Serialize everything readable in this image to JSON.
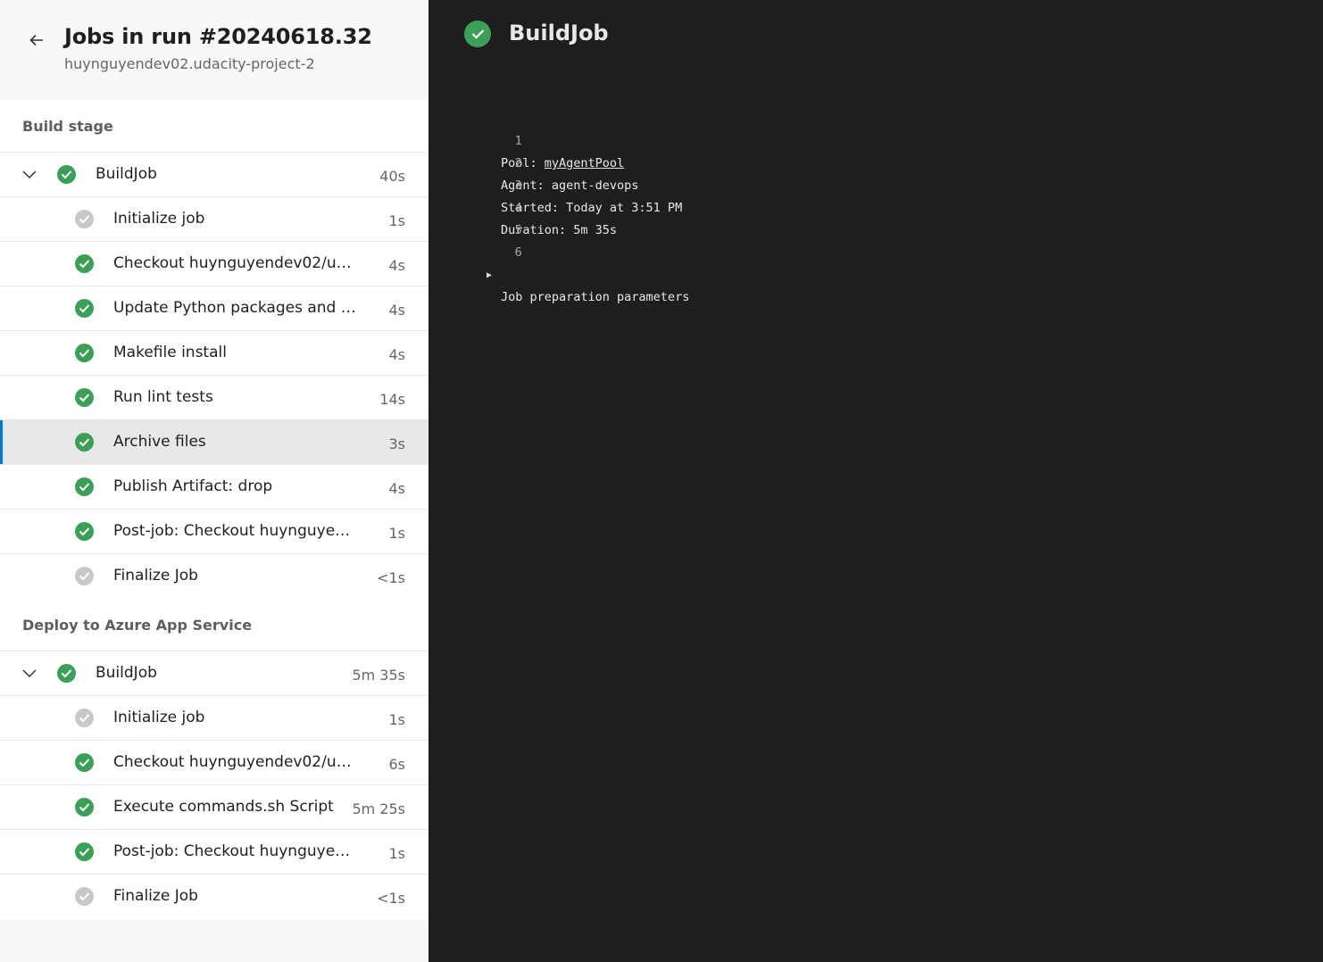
{
  "header": {
    "title": "Jobs in run #20240618.32",
    "subtitle": "huynguyendev02.udacity-project-2"
  },
  "stages": [
    {
      "name": "Build stage",
      "job": {
        "name": "BuildJob",
        "duration": "40s",
        "status": "success"
      },
      "steps": [
        {
          "name": "Initialize job",
          "duration": "1s",
          "status": "skipped"
        },
        {
          "name": "Checkout huynguyendev02/udaci...",
          "duration": "4s",
          "status": "success"
        },
        {
          "name": "Update Python packages and inst...",
          "duration": "4s",
          "status": "success"
        },
        {
          "name": "Makefile install",
          "duration": "4s",
          "status": "success"
        },
        {
          "name": "Run lint tests",
          "duration": "14s",
          "status": "success"
        },
        {
          "name": "Archive files",
          "duration": "3s",
          "status": "success",
          "selected": true
        },
        {
          "name": "Publish Artifact: drop",
          "duration": "4s",
          "status": "success"
        },
        {
          "name": "Post-job: Checkout huynguyende...",
          "duration": "1s",
          "status": "success"
        },
        {
          "name": "Finalize Job",
          "duration": "<1s",
          "status": "skipped"
        }
      ]
    },
    {
      "name": "Deploy to Azure App Service",
      "job": {
        "name": "BuildJob",
        "duration": "5m 35s",
        "status": "success"
      },
      "steps": [
        {
          "name": "Initialize job",
          "duration": "1s",
          "status": "skipped"
        },
        {
          "name": "Checkout huynguyendev02/udaci...",
          "duration": "6s",
          "status": "success"
        },
        {
          "name": "Execute commands.sh Script",
          "duration": "5m 25s",
          "status": "success"
        },
        {
          "name": "Post-job: Checkout huynguyende...",
          "duration": "1s",
          "status": "success"
        },
        {
          "name": "Finalize Job",
          "duration": "<1s",
          "status": "skipped"
        }
      ]
    }
  ],
  "detail": {
    "title": "BuildJob",
    "log": [
      {
        "n": "1",
        "prefix": "Pool: ",
        "link": "myAgentPool"
      },
      {
        "n": "2",
        "text": "Agent: agent-devops"
      },
      {
        "n": "3",
        "text": "Started: Today at 3:51 PM"
      },
      {
        "n": "4",
        "text": "Duration: 5m 35s"
      },
      {
        "n": "5",
        "text": ""
      },
      {
        "n": "6",
        "text": "Job preparation parameters",
        "expandable": true
      }
    ]
  },
  "colors": {
    "success": "#3c9f58",
    "skipped": "#c8c8c8",
    "accent": "#0078d4",
    "log_bg": "#1e1e1e"
  },
  "icons": {
    "back": "arrow-left-icon",
    "expand": "chevron-down-icon",
    "success": "check-circle-icon",
    "skipped": "check-circle-gray-icon",
    "toggle": "triangle-right-icon"
  }
}
